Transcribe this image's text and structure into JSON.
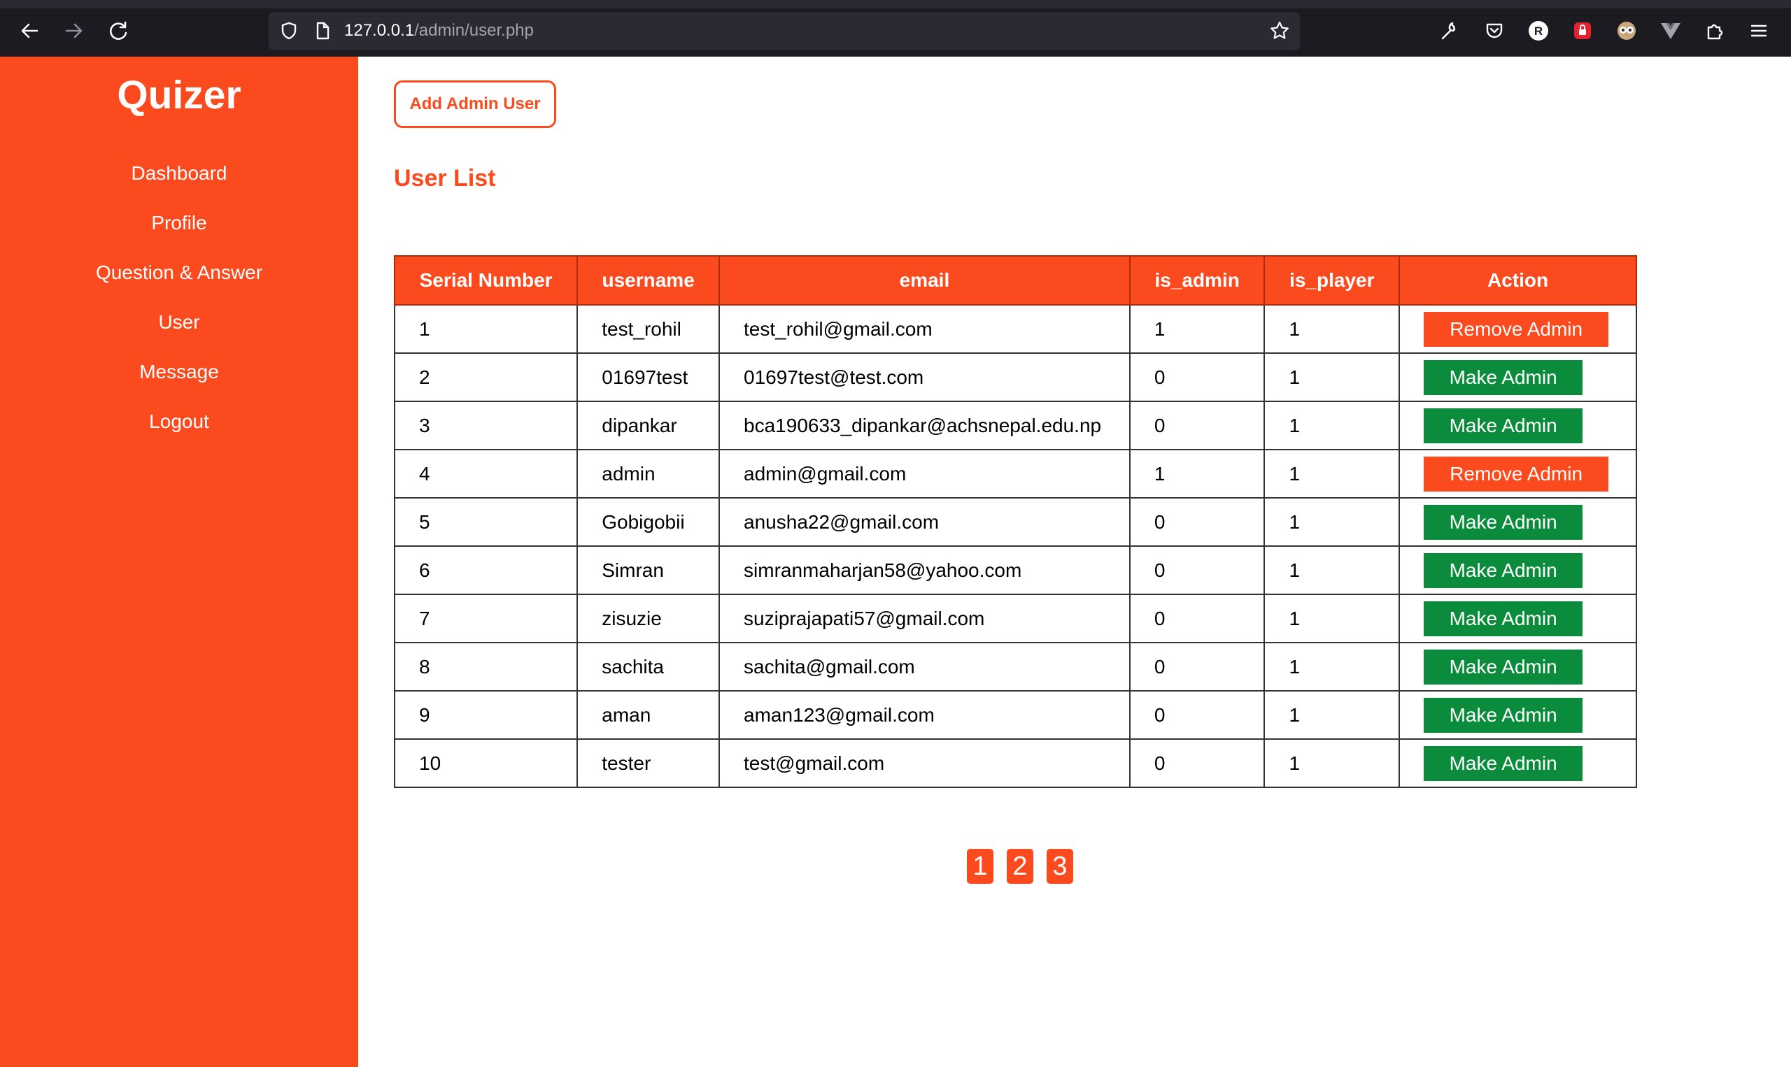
{
  "browser": {
    "url_host": "127.0.0.1",
    "url_path": "/admin/user.php",
    "extension_badge": "R"
  },
  "sidebar": {
    "brand": "Quizer",
    "items": [
      {
        "label": "Dashboard"
      },
      {
        "label": "Profile"
      },
      {
        "label": "Question & Answer"
      },
      {
        "label": "User"
      },
      {
        "label": "Message"
      },
      {
        "label": "Logout"
      }
    ]
  },
  "main": {
    "add_button_label": "Add Admin User",
    "title": "User List",
    "table": {
      "headers": [
        "Serial Number",
        "username",
        "email",
        "is_admin",
        "is_player",
        "Action"
      ],
      "rows": [
        {
          "serial": "1",
          "username": "test_rohil",
          "email": "test_rohil@gmail.com",
          "is_admin": "1",
          "is_player": "1",
          "action": "Remove Admin"
        },
        {
          "serial": "2",
          "username": "01697test",
          "email": "01697test@test.com",
          "is_admin": "0",
          "is_player": "1",
          "action": "Make Admin"
        },
        {
          "serial": "3",
          "username": "dipankar",
          "email": "bca190633_dipankar@achsnepal.edu.np",
          "is_admin": "0",
          "is_player": "1",
          "action": "Make Admin"
        },
        {
          "serial": "4",
          "username": "admin",
          "email": "admin@gmail.com",
          "is_admin": "1",
          "is_player": "1",
          "action": "Remove Admin"
        },
        {
          "serial": "5",
          "username": "Gobigobii",
          "email": "anusha22@gmail.com",
          "is_admin": "0",
          "is_player": "1",
          "action": "Make Admin"
        },
        {
          "serial": "6",
          "username": "Simran",
          "email": "simranmaharjan58@yahoo.com",
          "is_admin": "0",
          "is_player": "1",
          "action": "Make Admin"
        },
        {
          "serial": "7",
          "username": "zisuzie",
          "email": "suziprajapati57@gmail.com",
          "is_admin": "0",
          "is_player": "1",
          "action": "Make Admin"
        },
        {
          "serial": "8",
          "username": "sachita",
          "email": "sachita@gmail.com",
          "is_admin": "0",
          "is_player": "1",
          "action": "Make Admin"
        },
        {
          "serial": "9",
          "username": "aman",
          "email": "aman123@gmail.com",
          "is_admin": "0",
          "is_player": "1",
          "action": "Make Admin"
        },
        {
          "serial": "10",
          "username": "tester",
          "email": "test@gmail.com",
          "is_admin": "0",
          "is_player": "1",
          "action": "Make Admin"
        }
      ]
    },
    "pagination": [
      "1",
      "2",
      "3"
    ]
  },
  "colors": {
    "accent": "#fb4a1e",
    "make_admin": "#0a8c3c",
    "browser_bg": "#1c1b22"
  }
}
